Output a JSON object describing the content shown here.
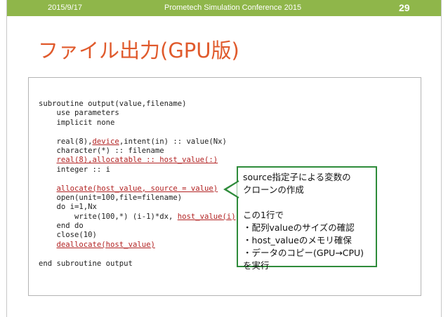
{
  "header": {
    "date": "2015/9/17",
    "conference": "Prometech Simulation Conference 2015",
    "page_number": "29"
  },
  "title": "ファイル出力(GPU版)",
  "code_lines": [
    [
      {
        "t": "subroutine output(value,filename)"
      }
    ],
    [
      {
        "t": "    use parameters"
      }
    ],
    [
      {
        "t": "    implicit none"
      }
    ],
    [
      {
        "t": ""
      }
    ],
    [
      {
        "t": "    real(8),"
      },
      {
        "t": "device",
        "u": true
      },
      {
        "t": ",intent(in) :: value(Nx)"
      }
    ],
    [
      {
        "t": "    character(*) :: filename"
      }
    ],
    [
      {
        "t": "    "
      },
      {
        "t": "real(8),allocatable :: host_value(:)",
        "u": true
      }
    ],
    [
      {
        "t": "    integer :: i"
      }
    ],
    [
      {
        "t": ""
      }
    ],
    [
      {
        "t": "    "
      },
      {
        "t": "allocate(host_value, source = value)",
        "u": true
      }
    ],
    [
      {
        "t": "    open(unit=100,file=filename)"
      }
    ],
    [
      {
        "t": "    do i=1,Nx"
      }
    ],
    [
      {
        "t": "        write(100,*) (i-1)*dx, "
      },
      {
        "t": "host_value(i)",
        "u": true
      }
    ],
    [
      {
        "t": "    end do"
      }
    ],
    [
      {
        "t": "    close(10)"
      }
    ],
    [
      {
        "t": "    "
      },
      {
        "t": "deallocate(host_value)",
        "u": true
      }
    ],
    [
      {
        "t": ""
      }
    ],
    [
      {
        "t": "end subroutine output"
      }
    ]
  ],
  "callout": {
    "lines": [
      "source指定子による変数の",
      "クローンの作成",
      "",
      "この1行で",
      "・配列valueのサイズの確認",
      "・host_valueのメモリ確保",
      "・データのコピー(GPU→CPU)",
      "を実行"
    ]
  },
  "colors": {
    "header_bar": "#8fb64a",
    "title": "#e05a2c",
    "underline_text": "#b22222",
    "callout_border": "#2e8b3a"
  }
}
